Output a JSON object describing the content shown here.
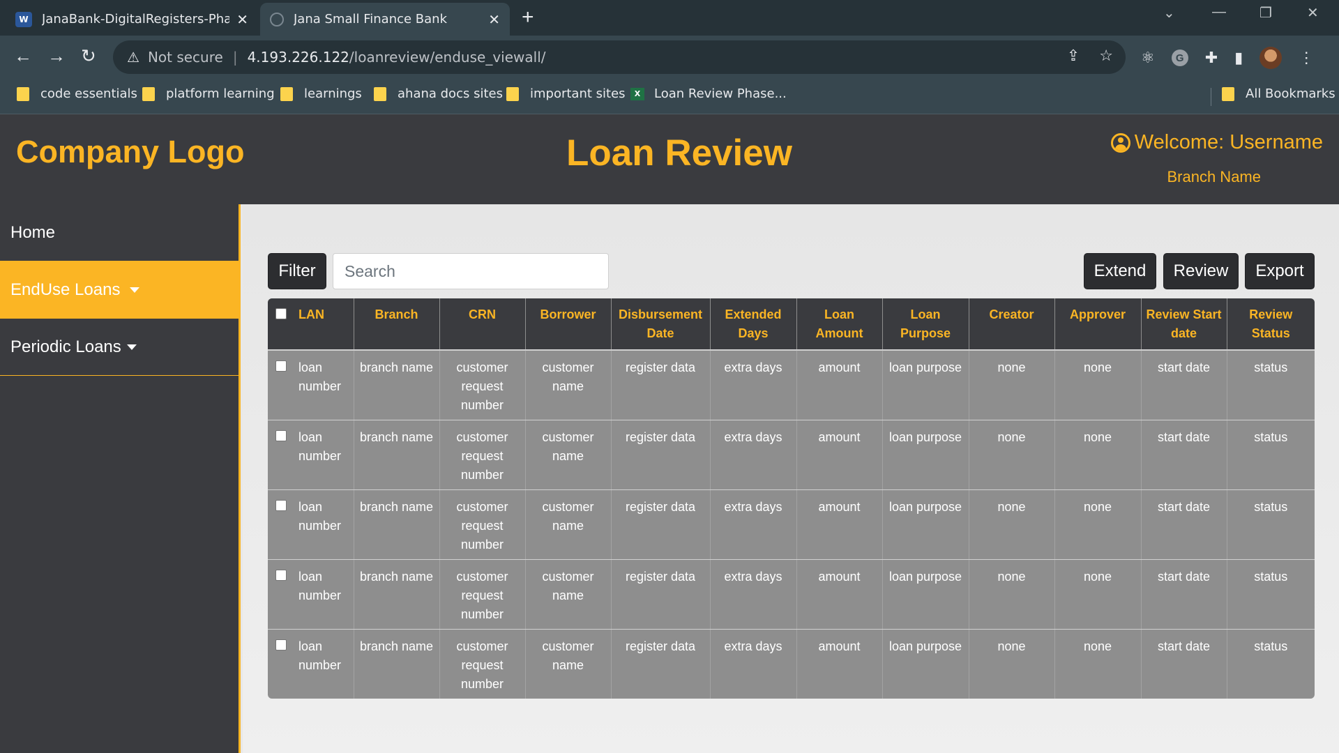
{
  "browser": {
    "tabs": [
      {
        "title": "JanaBank-DigitalRegisters-Phase",
        "icon": "word-doc-icon"
      },
      {
        "title": "Jana Small Finance Bank",
        "icon": "globe-icon"
      }
    ],
    "address": {
      "security_label": "Not secure",
      "host": "4.193.226.122",
      "path": "/loanreview/enduse_viewall/"
    },
    "bookmarks": [
      {
        "label": "code essentials",
        "icon": "folder-icon"
      },
      {
        "label": "platform learning",
        "icon": "folder-icon"
      },
      {
        "label": "learnings",
        "icon": "folder-icon"
      },
      {
        "label": "ahana docs sites",
        "icon": "folder-icon"
      },
      {
        "label": "important sites",
        "icon": "folder-icon"
      },
      {
        "label": "Loan Review Phase...",
        "icon": "excel-icon"
      }
    ],
    "all_bookmarks": "All Bookmarks"
  },
  "header": {
    "logo": "Company Logo",
    "title": "Loan Review",
    "welcome": "Welcome: Username",
    "branch": "Branch Name"
  },
  "sidebar": {
    "items": [
      {
        "label": "Home"
      },
      {
        "label": "EndUse Loans"
      },
      {
        "label": "Periodic Loans"
      }
    ]
  },
  "toolbar": {
    "filter_label": "Filter",
    "search_placeholder": "Search",
    "extend_label": "Extend",
    "review_label": "Review",
    "export_label": "Export"
  },
  "table": {
    "columns": [
      "LAN",
      "Branch",
      "CRN",
      "Borrower",
      "Disbursement Date",
      "Extended Days",
      "Loan Amount",
      "Loan Purpose",
      "Creator",
      "Approver",
      "Review Start date",
      "Review Status"
    ],
    "rows": [
      [
        "loan number",
        "branch name",
        "customer request number",
        "customer name",
        "register data",
        "extra days",
        "amount",
        "loan purpose",
        "none",
        "none",
        "start date",
        "status"
      ],
      [
        "loan number",
        "branch name",
        "customer request number",
        "customer name",
        "register data",
        "extra days",
        "amount",
        "loan purpose",
        "none",
        "none",
        "start date",
        "status"
      ],
      [
        "loan number",
        "branch name",
        "customer request number",
        "customer name",
        "register data",
        "extra days",
        "amount",
        "loan purpose",
        "none",
        "none",
        "start date",
        "status"
      ],
      [
        "loan number",
        "branch name",
        "customer request number",
        "customer name",
        "register data",
        "extra days",
        "amount",
        "loan purpose",
        "none",
        "none",
        "start date",
        "status"
      ],
      [
        "loan number",
        "branch name",
        "customer request number",
        "customer name",
        "register data",
        "extra days",
        "amount",
        "loan purpose",
        "none",
        "none",
        "start date",
        "status"
      ]
    ]
  },
  "colors": {
    "accent": "#fbb524",
    "dark": "#3a3b3f",
    "table_body": "#8e8e8e"
  }
}
